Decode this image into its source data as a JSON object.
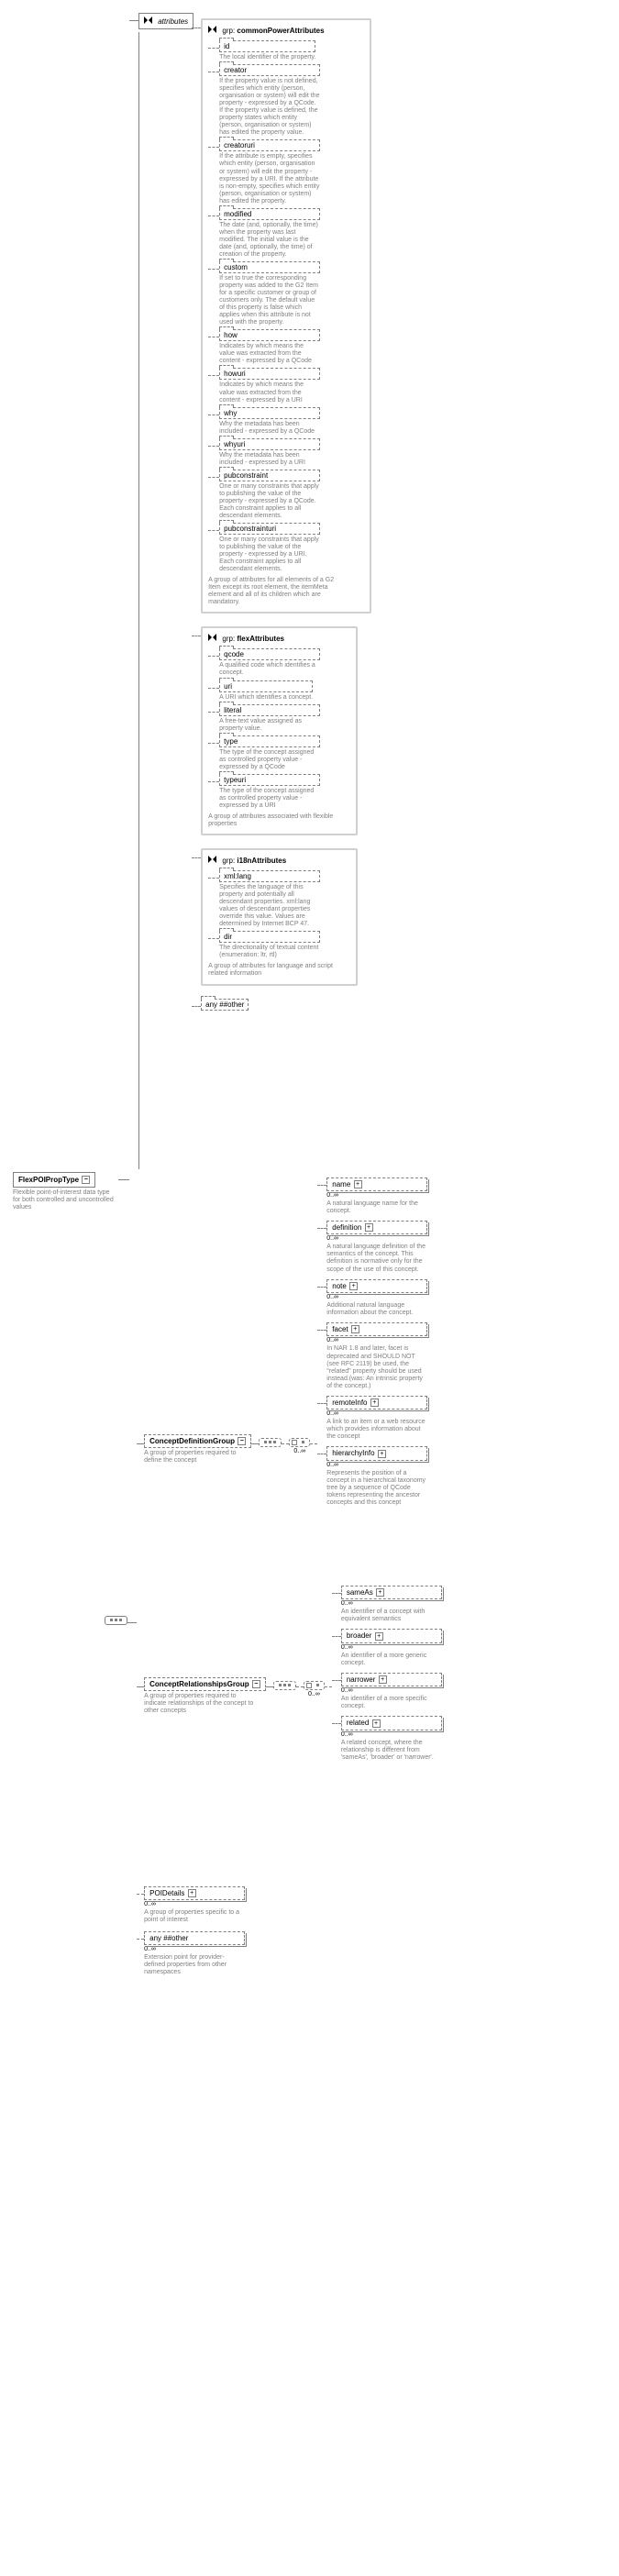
{
  "root": {
    "name": "FlexPOIPropType",
    "desc": "Flexible point-of-interest data type for both controlled and uncontrolled values"
  },
  "attributes_label": "attributes",
  "grp_label": "grp:",
  "groups": {
    "cpa": {
      "name": "commonPowerAttributes",
      "collapse_desc": "A group of attributes for all elements of a G2 Item except its root element, the itemMeta element and all of its children which are mandatory.",
      "items": [
        {
          "name": "id",
          "desc": "The local identifier of the property."
        },
        {
          "name": "creator",
          "desc": "If the property value is not defined, specifies which entity (person, organisation or system) will edit the property - expressed by a QCode. If the property value is defined, the property states which entity (person, organisation or system) has edited the property value."
        },
        {
          "name": "creatoruri",
          "desc": "If the attribute is empty, specifies which entity (person, organisation or system) will edit the property - expressed by a URI. If the attribute is non-empty, specifies which entity (person, organisation or system) has edited the property."
        },
        {
          "name": "modified",
          "desc": "The date (and, optionally, the time) when the property was last modified. The initial value is the date (and, optionally, the time) of creation of the property."
        },
        {
          "name": "custom",
          "desc": "If set to true the corresponding property was added to the G2 Item for a specific customer or group of customers only. The default value of this property is false which applies when this attribute is not used with the property."
        },
        {
          "name": "how",
          "desc": "Indicates by which means the value was extracted from the content - expressed by a QCode"
        },
        {
          "name": "howuri",
          "desc": "Indicates by which means the value was extracted from the content - expressed by a URI"
        },
        {
          "name": "why",
          "desc": "Why the metadata has been included - expressed by a QCode"
        },
        {
          "name": "whyuri",
          "desc": "Why the metadata has been included - expressed by a URI"
        },
        {
          "name": "pubconstraint",
          "desc": "One or many constraints that apply to publishing the value of the property - expressed by a QCode. Each constraint applies to all descendant elements."
        },
        {
          "name": "pubconstrainturi",
          "desc": "One or many constraints that apply to publishing the value of the property - expressed by a URI. Each constraint applies to all descendant elements."
        }
      ]
    },
    "flex": {
      "name": "flexAttributes",
      "collapse_desc": "A group of attributes associated with flexible properties",
      "items": [
        {
          "name": "qcode",
          "desc": "A qualified code which identifies a concept."
        },
        {
          "name": "uri",
          "desc": "A URI which identifies a concept."
        },
        {
          "name": "literal",
          "desc": "A free-text value assigned as property value."
        },
        {
          "name": "type",
          "desc": "The type of the concept assigned as controlled property value - expressed by a QCode"
        },
        {
          "name": "typeuri",
          "desc": "The type of the concept assigned as controlled property value - expressed by a URI"
        }
      ]
    },
    "i18n": {
      "name": "i18nAttributes",
      "collapse_desc": "A group of attributes for language and script related information",
      "items": [
        {
          "name": "xml:lang",
          "desc": "Specifies the language of this property and potentially all descendant properties. xml:lang values of descendant properties override this value. Values are determined by Internet BCP 47."
        },
        {
          "name": "dir",
          "desc": "The directionality of textual content (enumeration: ltr, rtl)"
        }
      ]
    }
  },
  "any_other": "any ##other",
  "cdg": {
    "name": "ConceptDefinitionGroup",
    "desc": "A group of properties required to define the concept",
    "items": [
      {
        "name": "name",
        "desc": "A natural language name for the concept."
      },
      {
        "name": "definition",
        "desc": "A natural language definition of the semantics of the concept. This definition is normative only for the scope of the use of this concept."
      },
      {
        "name": "note",
        "desc": "Additional natural language information about the concept."
      },
      {
        "name": "facet",
        "desc": "In NAR 1.8 and later, facet is deprecated and SHOULD NOT (see RFC 2119) be used, the \"related\" property should be used instead.(was: An intrinsic property of the concept.)"
      },
      {
        "name": "remoteInfo",
        "desc": "A link to an item or a web resource which provides information about the concept"
      },
      {
        "name": "hierarchyInfo",
        "desc": "Represents the position of a concept in a hierarchical taxonomy tree by a sequence of QCode tokens representing the ancestor concepts and this concept"
      }
    ]
  },
  "crg": {
    "name": "ConceptRelationshipsGroup",
    "desc": "A group of properties required to indicate relationships of the concept to other concepts",
    "items": [
      {
        "name": "sameAs",
        "desc": "An identifier of a concept with equivalent semantics"
      },
      {
        "name": "broader",
        "desc": "An identifier of a more generic concept."
      },
      {
        "name": "narrower",
        "desc": "An identifier of a more specific concept."
      },
      {
        "name": "related",
        "desc": "A related concept, where the relationship is different from 'sameAs', 'broader' or 'narrower'."
      }
    ]
  },
  "poi": {
    "name": "POIDetails",
    "desc": "A group of properties specific to a point of interest"
  },
  "any_other2": {
    "name": "any ##other",
    "desc": "Extension point for provider-defined properties from other namespaces"
  },
  "card_0inf": "0..∞"
}
